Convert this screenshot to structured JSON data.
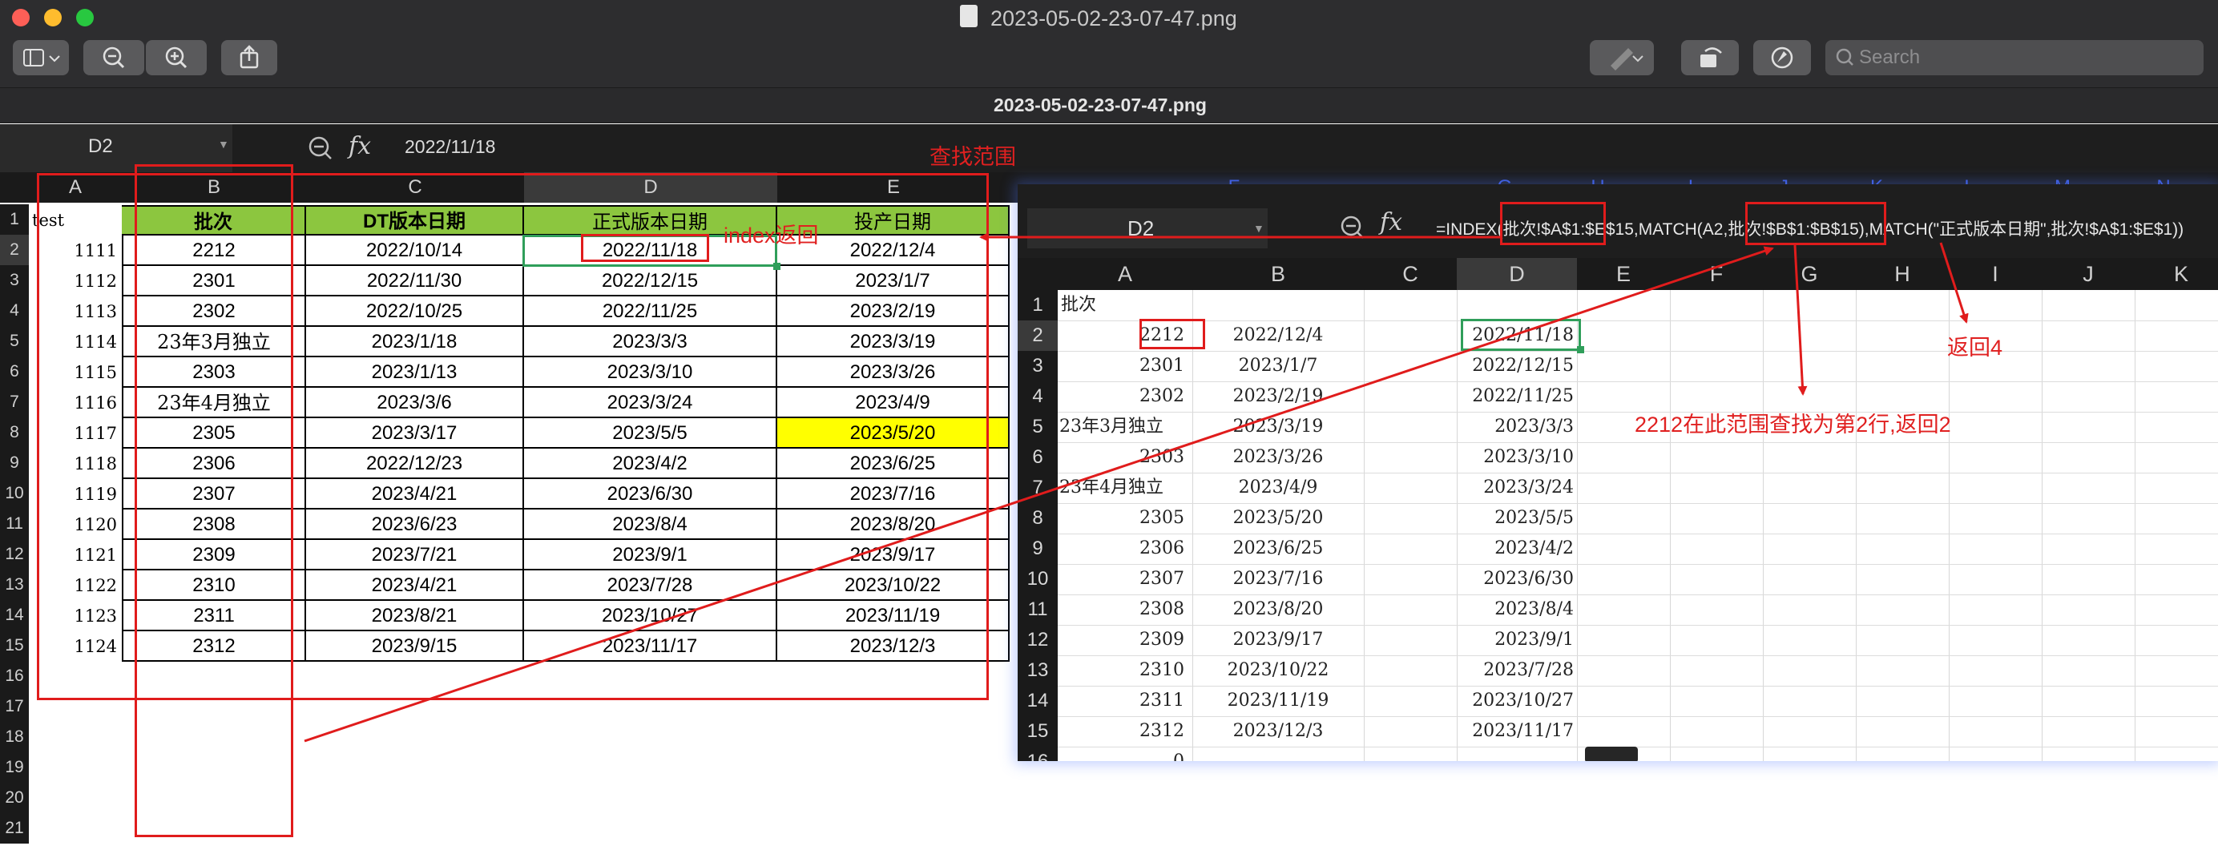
{
  "window": {
    "title": "2023-05-02-23-07-47.png",
    "subtitle": "2023-05-02-23-07-47.png",
    "search_placeholder": "Search"
  },
  "toolbar": {
    "icons": [
      "sidebar-icon",
      "chevron-down-icon",
      "zoom-out-icon",
      "zoom-in-icon",
      "share-icon",
      "markup-pen-icon",
      "chevron-down-icon",
      "rotate-icon",
      "annotate-icon",
      "search-icon"
    ]
  },
  "sheet": {
    "name_box": "D2",
    "fx": "fx",
    "formula_value": "2022/11/18",
    "columns": [
      "A",
      "B",
      "C",
      "D",
      "E"
    ],
    "right_columns": [
      "F",
      "G",
      "H",
      "I",
      "J",
      "K",
      "L",
      "M",
      "N"
    ],
    "row_numbers": [
      "1",
      "2",
      "3",
      "4",
      "5",
      "6",
      "7",
      "8",
      "9",
      "10",
      "11",
      "12",
      "13",
      "14",
      "15",
      "16",
      "17",
      "18",
      "19",
      "20",
      "21"
    ],
    "corner_label": "test",
    "headers": [
      "批次",
      "DT版本日期",
      "正式版本日期",
      "投产日期"
    ],
    "rows": [
      {
        "a": "1111",
        "b": "2212",
        "c": "2022/10/14",
        "d": "2022/11/18",
        "e": "2022/12/4"
      },
      {
        "a": "1112",
        "b": "2301",
        "c": "2022/11/30",
        "d": "2022/12/15",
        "e": "2023/1/7"
      },
      {
        "a": "1113",
        "b": "2302",
        "c": "2022/10/25",
        "d": "2022/11/25",
        "e": "2023/2/19"
      },
      {
        "a": "1114",
        "b": "23年3月独立",
        "c": "2023/1/18",
        "d": "2023/3/3",
        "e": "2023/3/19"
      },
      {
        "a": "1115",
        "b": "2303",
        "c": "2023/1/13",
        "d": "2023/3/10",
        "e": "2023/3/26"
      },
      {
        "a": "1116",
        "b": "23年4月独立",
        "c": "2023/3/6",
        "d": "2023/3/24",
        "e": "2023/4/9"
      },
      {
        "a": "1117",
        "b": "2305",
        "c": "2023/3/17",
        "d": "2023/5/5",
        "e": "2023/5/20"
      },
      {
        "a": "1118",
        "b": "2306",
        "c": "2022/12/23",
        "d": "2023/4/2",
        "e": "2023/6/25"
      },
      {
        "a": "1119",
        "b": "2307",
        "c": "2023/4/21",
        "d": "2023/6/30",
        "e": "2023/7/16"
      },
      {
        "a": "1120",
        "b": "2308",
        "c": "2023/6/23",
        "d": "2023/8/4",
        "e": "2023/8/20"
      },
      {
        "a": "1121",
        "b": "2309",
        "c": "2023/7/21",
        "d": "2023/9/1",
        "e": "2023/9/17"
      },
      {
        "a": "1122",
        "b": "2310",
        "c": "2023/4/21",
        "d": "2023/7/28",
        "e": "2023/10/22"
      },
      {
        "a": "1123",
        "b": "2311",
        "c": "2023/8/21",
        "d": "2023/10/27",
        "e": "2023/11/19"
      },
      {
        "a": "1124",
        "b": "2312",
        "c": "2023/9/15",
        "d": "2023/11/17",
        "e": "2023/12/3"
      }
    ],
    "highlight_color": "#ffff00",
    "header_fill": "#8cc63f"
  },
  "overlay": {
    "name_box": "D2",
    "fx": "fx",
    "formula": "=INDEX(批次!$A$1:$E$15,MATCH(A2,批次!$B$1:$B$15),MATCH(\"正式版本日期\",批次!$A$1:$E$1))",
    "columns": [
      "A",
      "B",
      "C",
      "D",
      "E",
      "F",
      "G",
      "H",
      "I",
      "J",
      "K"
    ],
    "row_numbers": [
      "1",
      "2",
      "3",
      "4",
      "5",
      "6",
      "7",
      "8",
      "9",
      "10",
      "11",
      "12",
      "13",
      "14",
      "15",
      "16"
    ],
    "a1": "批次",
    "rows": [
      {
        "a": "2212",
        "b": "2022/12/4",
        "d": "2022/11/18"
      },
      {
        "a": "2301",
        "b": "2023/1/7",
        "d": "2022/12/15"
      },
      {
        "a": "2302",
        "b": "2023/2/19",
        "d": "2022/11/25"
      },
      {
        "a": "23年3月独立",
        "b": "2023/3/19",
        "d": "2023/3/3"
      },
      {
        "a": "2303",
        "b": "2023/3/26",
        "d": "2023/3/10"
      },
      {
        "a": "23年4月独立",
        "b": "2023/4/9",
        "d": "2023/3/24"
      },
      {
        "a": "2305",
        "b": "2023/5/20",
        "d": "2023/5/5"
      },
      {
        "a": "2306",
        "b": "2023/6/25",
        "d": "2023/4/2"
      },
      {
        "a": "2307",
        "b": "2023/7/16",
        "d": "2023/6/30"
      },
      {
        "a": "2308",
        "b": "2023/8/20",
        "d": "2023/8/4"
      },
      {
        "a": "2309",
        "b": "2023/9/17",
        "d": "2023/9/1"
      },
      {
        "a": "2310",
        "b": "2023/10/22",
        "d": "2023/7/28"
      },
      {
        "a": "2311",
        "b": "2023/11/19",
        "d": "2023/10/27"
      },
      {
        "a": "2312",
        "b": "2023/12/3",
        "d": "2023/11/17"
      },
      {
        "a": "0",
        "b": "",
        "d": ""
      }
    ]
  },
  "annotations": {
    "search_range": "查找范围",
    "index_return": "index返回",
    "match_row": "2212在此范围查找为第2行,返回2",
    "return4": "返回4",
    "color": "#e02020"
  }
}
